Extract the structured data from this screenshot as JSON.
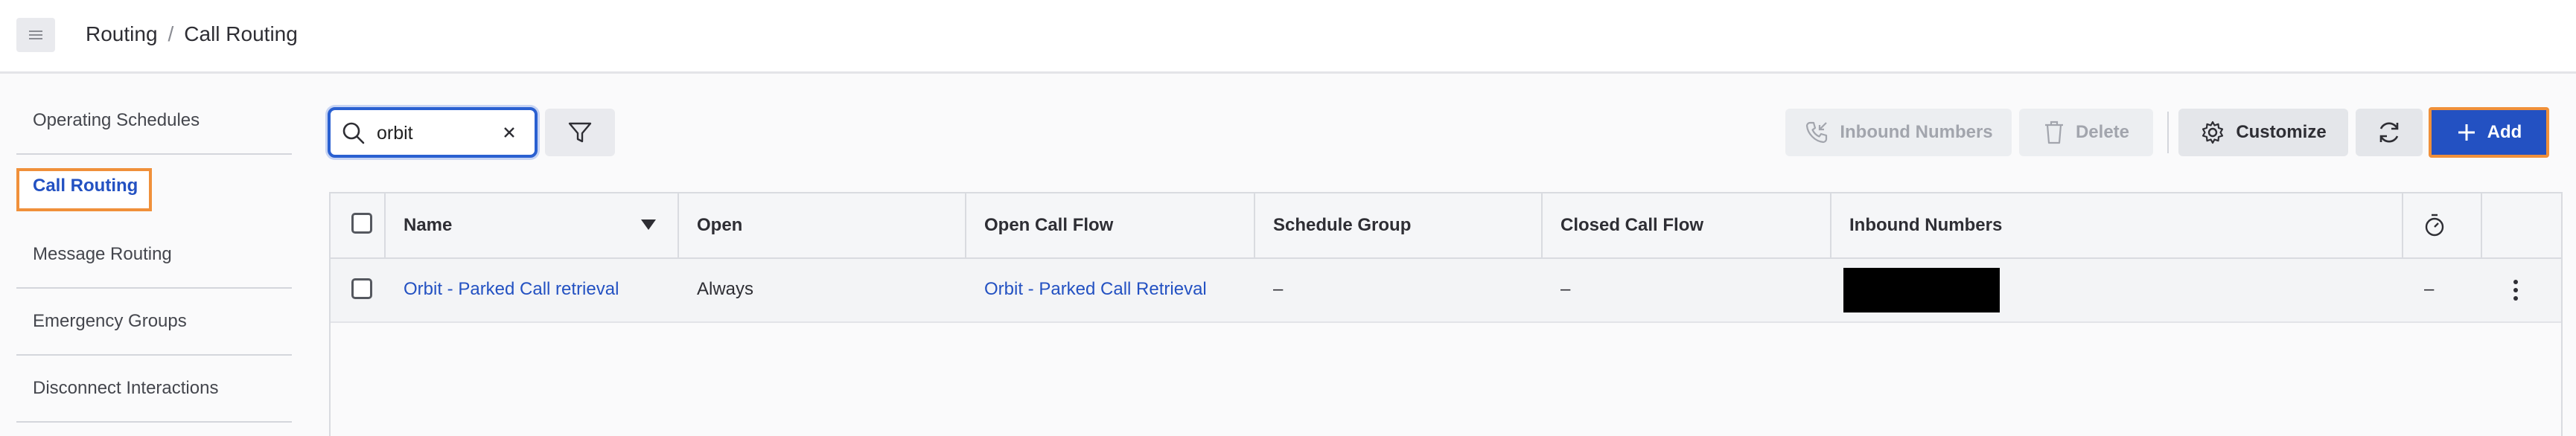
{
  "header": {
    "menu_icon": "hamburger-icon",
    "breadcrumb": {
      "parent": "Routing",
      "separator": "/",
      "current": "Call Routing"
    }
  },
  "sidebar": {
    "items": [
      {
        "label": "Operating Schedules",
        "active": false
      },
      {
        "label": "Call Routing",
        "active": true
      },
      {
        "label": "Message Routing",
        "active": false
      },
      {
        "label": "Emergency Groups",
        "active": false
      },
      {
        "label": "Disconnect Interactions",
        "active": false
      }
    ]
  },
  "toolbar": {
    "search_value": "orbit",
    "inbound_numbers_label": "Inbound Numbers",
    "delete_label": "Delete",
    "customize_label": "Customize",
    "add_label": "Add"
  },
  "table": {
    "columns": [
      "Name",
      "Open",
      "Open Call Flow",
      "Schedule Group",
      "Closed Call Flow",
      "Inbound Numbers"
    ],
    "rows": [
      {
        "name": "Orbit - Parked Call retrieval",
        "open": "Always",
        "open_call_flow": "Orbit - Parked Call Retrieval",
        "schedule_group": "–",
        "closed_call_flow": "–",
        "inbound_numbers": "",
        "extra": "–"
      }
    ]
  },
  "colors": {
    "accent": "#2351c2",
    "highlight": "#f0903a"
  }
}
